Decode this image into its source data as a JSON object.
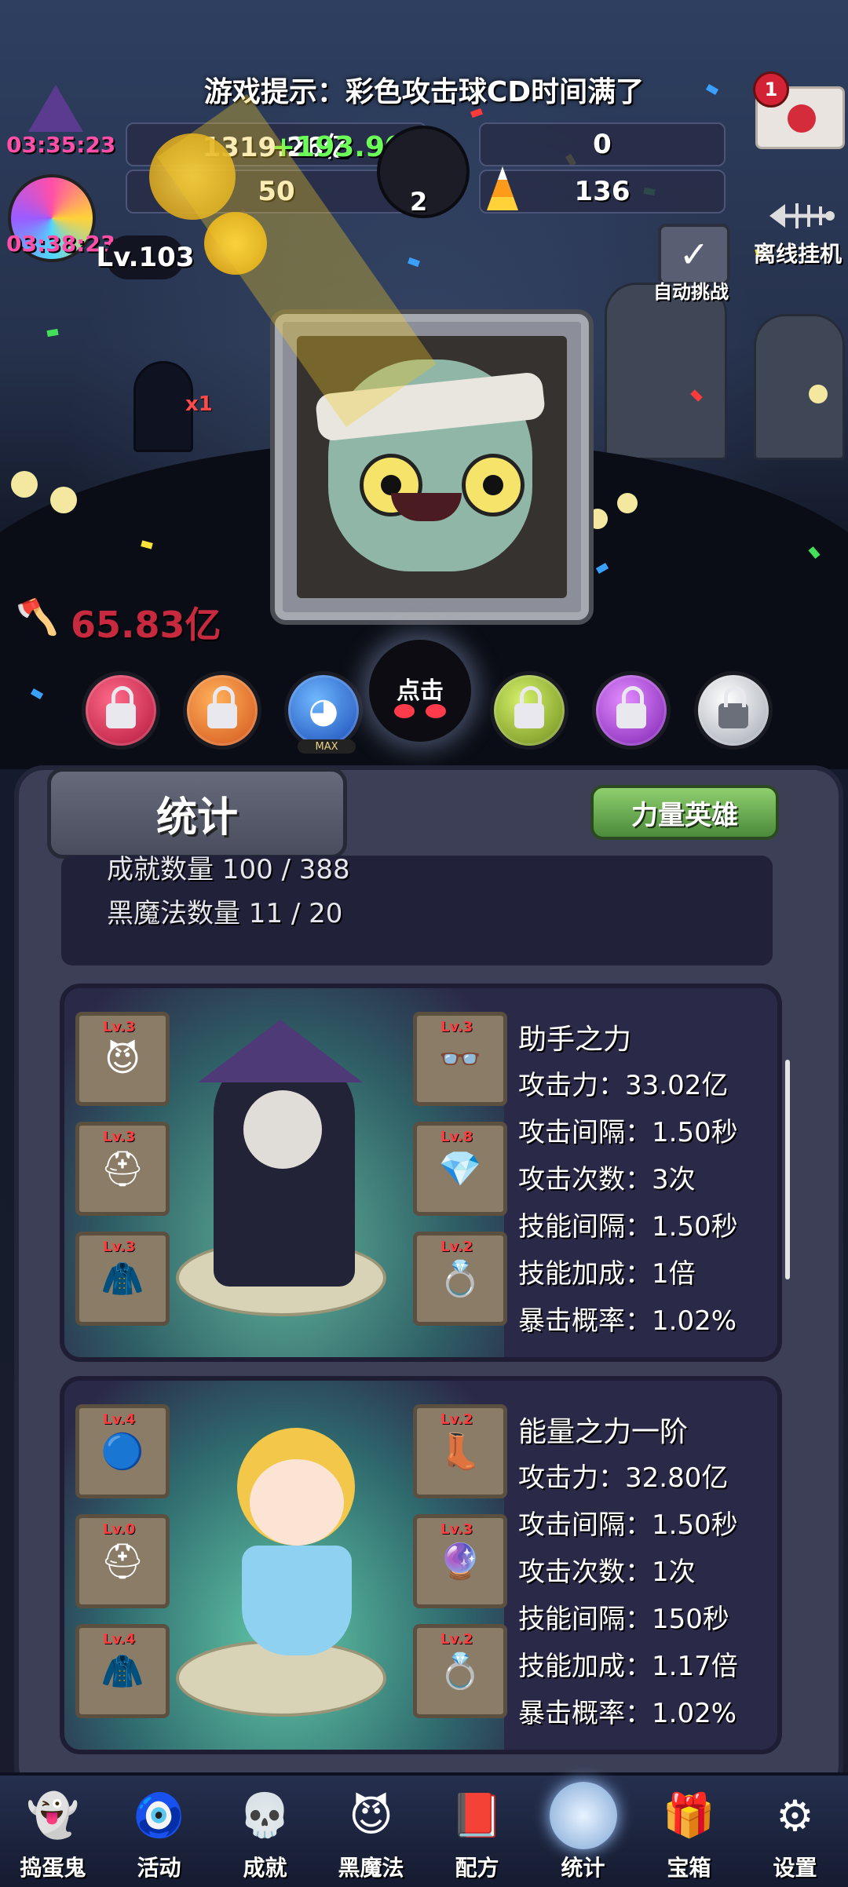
{
  "hint": "游戏提示：彩色攻击球CD时间满了",
  "timers": {
    "hat_timer": "03:35:23",
    "candy_timer": "03:38:23"
  },
  "resources": {
    "gold": "1319.26亿",
    "gold_gain": "+193.90亿",
    "gems": "50",
    "cauldron": "2",
    "skull_value": "0",
    "candy_corn": "136"
  },
  "level": "Lv.103",
  "mail_count": "1",
  "offline_label": "离线挂机",
  "auto_challenge_label": "自动挑战",
  "damage": "65.83亿",
  "orbs": {
    "tap_label": "点击",
    "max_tag": "MAX",
    "axe_x1": "x1"
  },
  "panel": {
    "title": "统计",
    "power_hero_button": "力量英雄",
    "summary_partial": "成就数量 100 / 388",
    "black_magic_count": "黑魔法数量 11 / 20"
  },
  "heroes": [
    {
      "title": "助手之力",
      "stats": [
        "攻击力：33.02亿",
        "攻击间隔：1.50秒",
        "攻击次数：3次",
        "技能间隔：1.50秒",
        "技能加成：1倍",
        "暴击概率：1.02%"
      ],
      "slots": [
        "Lv.3",
        "Lv.3",
        "Lv.3",
        "Lv.3",
        "Lv.8",
        "Lv.2"
      ]
    },
    {
      "title": "能量之力一阶",
      "stats": [
        "攻击力：32.80亿",
        "攻击间隔：1.50秒",
        "攻击次数：1次",
        "技能间隔：150秒",
        "技能加成：1.17倍",
        "暴击概率：1.02%"
      ],
      "slots": [
        "Lv.4",
        "Lv.0",
        "Lv.4",
        "Lv.2",
        "Lv.3",
        "Lv.2"
      ]
    }
  ],
  "nav": [
    "捣蛋鬼",
    "活动",
    "成就",
    "黑魔法",
    "配方",
    "统计",
    "宝箱",
    "设置"
  ]
}
